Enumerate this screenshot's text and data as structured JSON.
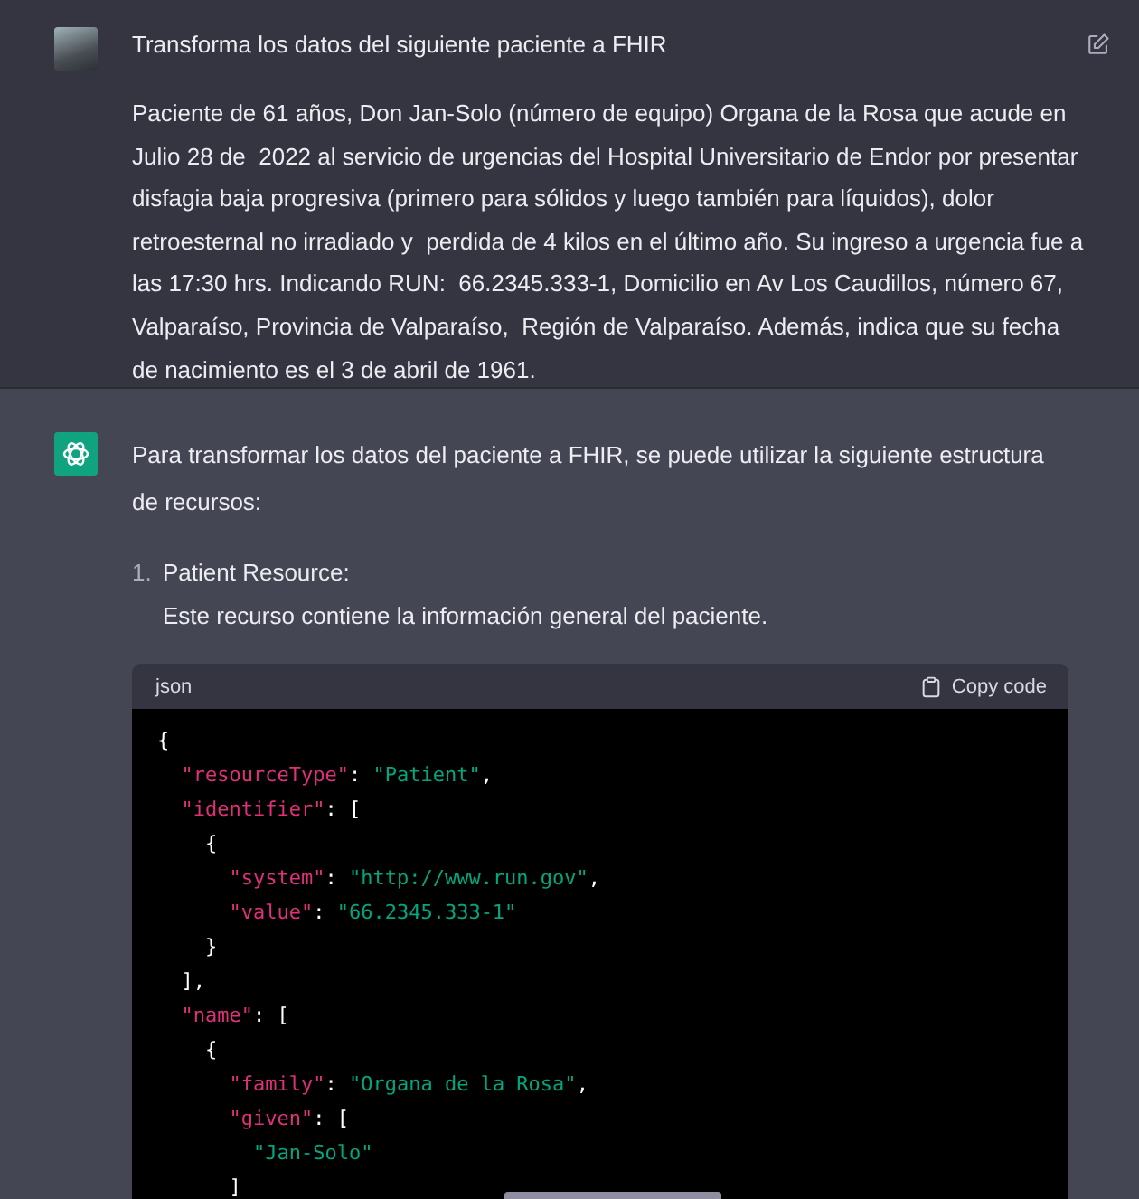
{
  "user_message": {
    "title": "Transforma los datos del siguiente paciente a FHIR",
    "body": "Paciente de 61 años, Don Jan-Solo (número de equipo) Organa de la Rosa que acude en Julio 28 de  2022 al servicio de urgencias del Hospital Universitario de Endor por presentar disfagia baja progresiva (primero para sólidos y luego también para líquidos), dolor retroesternal no irradiado y  perdida de 4 kilos en el último año. Su ingreso a urgencia fue a las 17:30 hrs. Indicando RUN:  66.2345.333-1, Domicilio en Av Los Caudillos, número 67, Valparaíso, Provincia de Valparaíso,  Región de Valparaíso. Además, indica que su fecha de nacimiento es el 3 de abril de 1961."
  },
  "assistant_message": {
    "intro": "Para transformar los datos del paciente a FHIR, se puede utilizar la siguiente estructura de recursos:",
    "list": [
      {
        "number": "1.",
        "title": "Patient Resource:",
        "description": "Este recurso contiene la información general del paciente."
      }
    ],
    "code_block": {
      "language": "json",
      "copy_label": "Copy code",
      "lines": [
        [
          {
            "kind": "punct",
            "text": "{"
          }
        ],
        [
          {
            "kind": "key",
            "text": "  \"resourceType\""
          },
          {
            "kind": "punct",
            "text": ": "
          },
          {
            "kind": "string",
            "text": "\"Patient\""
          },
          {
            "kind": "punct",
            "text": ","
          }
        ],
        [
          {
            "kind": "key",
            "text": "  \"identifier\""
          },
          {
            "kind": "punct",
            "text": ": ["
          }
        ],
        [
          {
            "kind": "punct",
            "text": "    {"
          }
        ],
        [
          {
            "kind": "key",
            "text": "      \"system\""
          },
          {
            "kind": "punct",
            "text": ": "
          },
          {
            "kind": "string",
            "text": "\"http://www.run.gov\""
          },
          {
            "kind": "punct",
            "text": ","
          }
        ],
        [
          {
            "kind": "key",
            "text": "      \"value\""
          },
          {
            "kind": "punct",
            "text": ": "
          },
          {
            "kind": "string",
            "text": "\"66.2345.333-1\""
          }
        ],
        [
          {
            "kind": "punct",
            "text": "    }"
          }
        ],
        [
          {
            "kind": "punct",
            "text": "  ],"
          }
        ],
        [
          {
            "kind": "key",
            "text": "  \"name\""
          },
          {
            "kind": "punct",
            "text": ": ["
          }
        ],
        [
          {
            "kind": "punct",
            "text": "    {"
          }
        ],
        [
          {
            "kind": "key",
            "text": "      \"family\""
          },
          {
            "kind": "punct",
            "text": ": "
          },
          {
            "kind": "string",
            "text": "\"Organa de la Rosa\""
          },
          {
            "kind": "punct",
            "text": ","
          }
        ],
        [
          {
            "kind": "key",
            "text": "      \"given\""
          },
          {
            "kind": "punct",
            "text": ": ["
          }
        ],
        [
          {
            "kind": "string",
            "text": "        \"Jan-Solo\""
          }
        ],
        [
          {
            "kind": "punct",
            "text": "      ]"
          }
        ]
      ]
    }
  }
}
